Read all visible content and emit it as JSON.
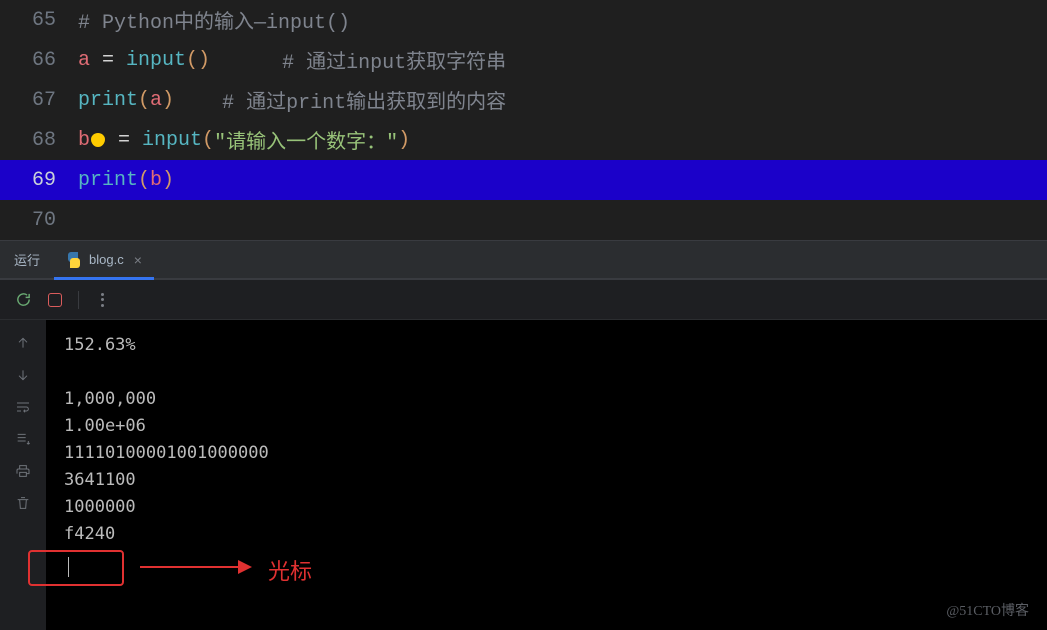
{
  "editor": {
    "lines": [
      {
        "num": "65",
        "c1": "# Python中的输入—input()"
      },
      {
        "num": "66",
        "var": "a",
        "eq": " = ",
        "fn": "input",
        "p1": "()",
        "sp": "      ",
        "cm": "# 通过input获取字符串"
      },
      {
        "num": "67",
        "fn": "print",
        "p1": "(",
        "var": "a",
        "p2": ")",
        "sp": "    ",
        "cm": "# 通过print输出获取到的内容"
      },
      {
        "num": "68",
        "var": "b",
        "eq": " = ",
        "fn": "input",
        "p1": "(",
        "str": "\"请输入一个数字：\"",
        "p2": ")"
      },
      {
        "num": "69",
        "fn": "print",
        "p1": "(",
        "var": "b",
        "p2": ")"
      },
      {
        "num": "70"
      }
    ]
  },
  "panel": {
    "run_label": "运行",
    "file_name": "blog.c",
    "close": "×"
  },
  "output": [
    "152.63%",
    "",
    "1,000,000",
    "1.00e+06",
    "11110100001001000000",
    "3641100",
    "1000000",
    "f4240"
  ],
  "annotation": "光标",
  "watermark": "@51CTO博客"
}
